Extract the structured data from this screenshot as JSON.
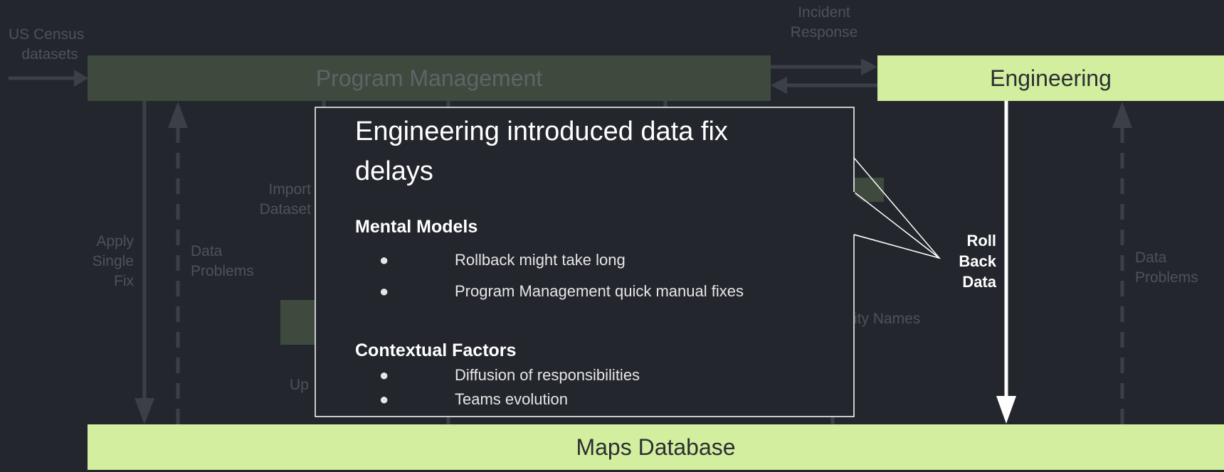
{
  "labels": {
    "us_census": [
      "US Census",
      "datasets"
    ],
    "incident_response": [
      "Incident",
      "Response"
    ],
    "apply_single_fix": [
      "Apply",
      "Single",
      "Fix"
    ],
    "data_problems_left": [
      "Data",
      "Problems"
    ],
    "import_dataset": [
      "Import",
      "Dataset"
    ],
    "city_names": "ity Names",
    "upd_partial": "Up",
    "data_problems_right": [
      "Data",
      "Problems"
    ],
    "roll_back_data": [
      "Roll",
      "Back",
      "Data"
    ]
  },
  "blocks": {
    "program_management": "Program Management",
    "engineering": "Engineering",
    "maps_database": "Maps Database"
  },
  "callout": {
    "title": "Engineering introduced data fix delays",
    "mental_models": {
      "heading": "Mental Models",
      "items": [
        "Rollback might take long",
        "Program Management quick manual fixes"
      ]
    },
    "contextual_factors": {
      "heading": "Contextual Factors",
      "items": [
        "Diffusion of responsibilities",
        "Teams evolution"
      ]
    },
    "bullet_glyph": "●"
  },
  "colors": {
    "background": "#23262d",
    "highlight_block": "#d2ee9e",
    "dim_block": "#3e4a3e",
    "dim_text": "#4d525a",
    "dim_line": "#3b4048"
  }
}
